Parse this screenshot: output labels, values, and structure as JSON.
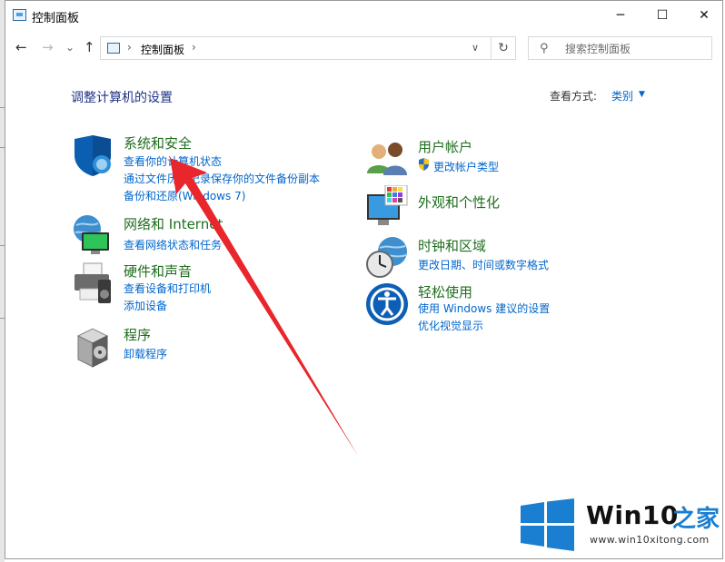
{
  "window": {
    "title": "控制面板",
    "controls": {
      "minimize": "─",
      "maximize": "☐",
      "close": "✕"
    }
  },
  "nav": {
    "back": "←",
    "forward": "→",
    "recent": "⌄",
    "up": "↑",
    "breadcrumb": "控制面板",
    "separator": "›",
    "refresh": "↻",
    "search_placeholder": "搜索控制面板"
  },
  "main": {
    "page_title": "调整计算机的设置",
    "view_by_label": "查看方式:",
    "view_by_value": "类别"
  },
  "categories_left": [
    {
      "icon": "security-shield-icon",
      "title": "系统和安全",
      "links": [
        "查看你的计算机状态",
        "通过文件历史记录保存你的文件备份副本",
        "备份和还原(Windows 7)"
      ]
    },
    {
      "icon": "network-globe-icon",
      "title": "网络和 Internet",
      "links": [
        "查看网络状态和任务"
      ]
    },
    {
      "icon": "printer-speaker-icon",
      "title": "硬件和声音",
      "links": [
        "查看设备和打印机",
        "添加设备"
      ]
    },
    {
      "icon": "programs-box-icon",
      "title": "程序",
      "links": [
        "卸载程序"
      ]
    }
  ],
  "categories_right": [
    {
      "icon": "user-accounts-icon",
      "title": "用户帐户",
      "links": [
        "更改帐户类型"
      ]
    },
    {
      "icon": "appearance-monitor-icon",
      "title": "外观和个性化",
      "links": []
    },
    {
      "icon": "clock-globe-icon",
      "title": "时钟和区域",
      "links": [
        "更改日期、时间或数字格式"
      ]
    },
    {
      "icon": "ease-of-access-icon",
      "title": "轻松使用",
      "links": [
        "使用 Windows 建议的设置",
        "优化视觉显示"
      ]
    }
  ],
  "watermark": {
    "brand": "Win10",
    "brand_suffix": "之家",
    "url": "www.win10xitong.com"
  },
  "colors": {
    "category_title": "#1e6e1e",
    "link": "#0066cc",
    "page_title": "#1e3287",
    "annotation_arrow": "#e8262b",
    "watermark_blue": "#1a7fd0"
  }
}
